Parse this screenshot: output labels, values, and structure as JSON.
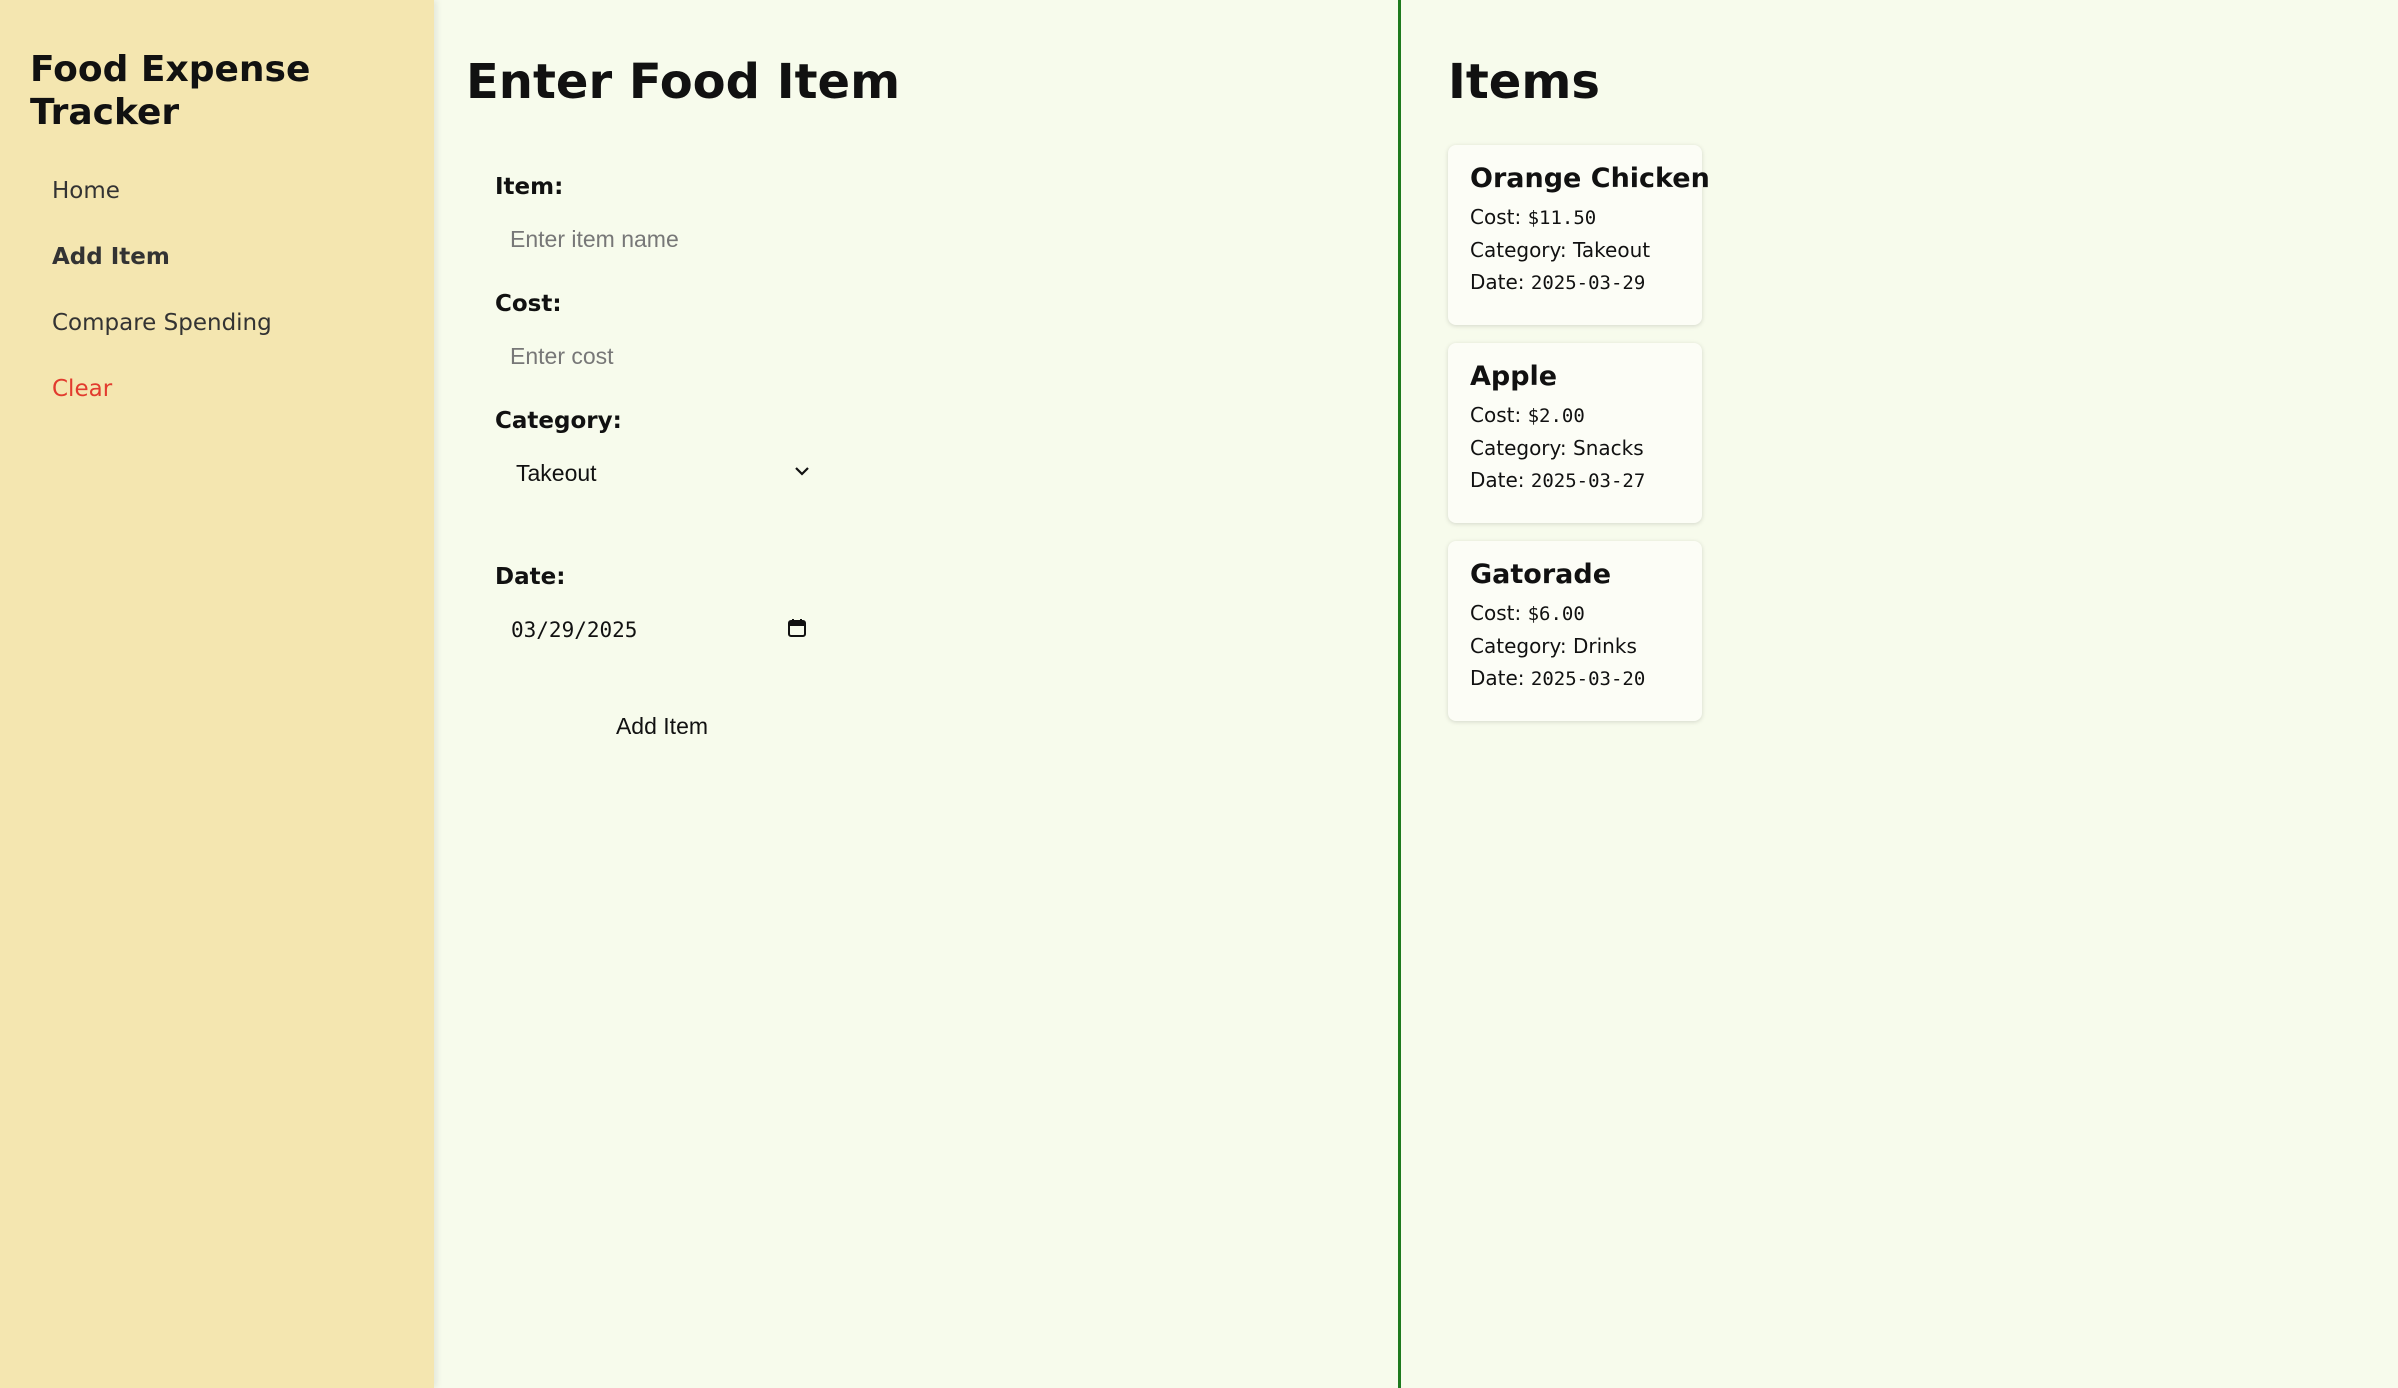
{
  "sidebar": {
    "title": "Food Expense Tracker",
    "items": [
      {
        "label": "Home"
      },
      {
        "label": "Add Item"
      },
      {
        "label": "Compare Spending"
      },
      {
        "label": "Clear"
      }
    ]
  },
  "form": {
    "title": "Enter Food Item",
    "item_label": "Item:",
    "item_placeholder": "Enter item name",
    "cost_label": "Cost:",
    "cost_placeholder": "Enter cost",
    "category_label": "Category:",
    "category_value": "Takeout",
    "date_label": "Date:",
    "date_value": "03/29/2025",
    "submit_label": "Add Item"
  },
  "items": {
    "title": "Items",
    "cost_prefix": "Cost:",
    "category_prefix": "Category:",
    "date_prefix": "Date:",
    "list": [
      {
        "name": "Orange Chicken",
        "cost": "$11.50",
        "category": "Takeout",
        "date": "2025-03-29"
      },
      {
        "name": "Apple",
        "cost": "$2.00",
        "category": "Snacks",
        "date": "2025-03-27"
      },
      {
        "name": "Gatorade",
        "cost": "$6.00",
        "category": "Drinks",
        "date": "2025-03-20"
      }
    ]
  },
  "colors": {
    "sidebar_bg": "#f4e6b0",
    "main_bg": "#f7fbec",
    "divider": "#1e7a1e",
    "clear_link": "#e23b2e"
  },
  "icons": {
    "category_select": "chevron-down-icon",
    "date_input": "calendar-icon"
  }
}
